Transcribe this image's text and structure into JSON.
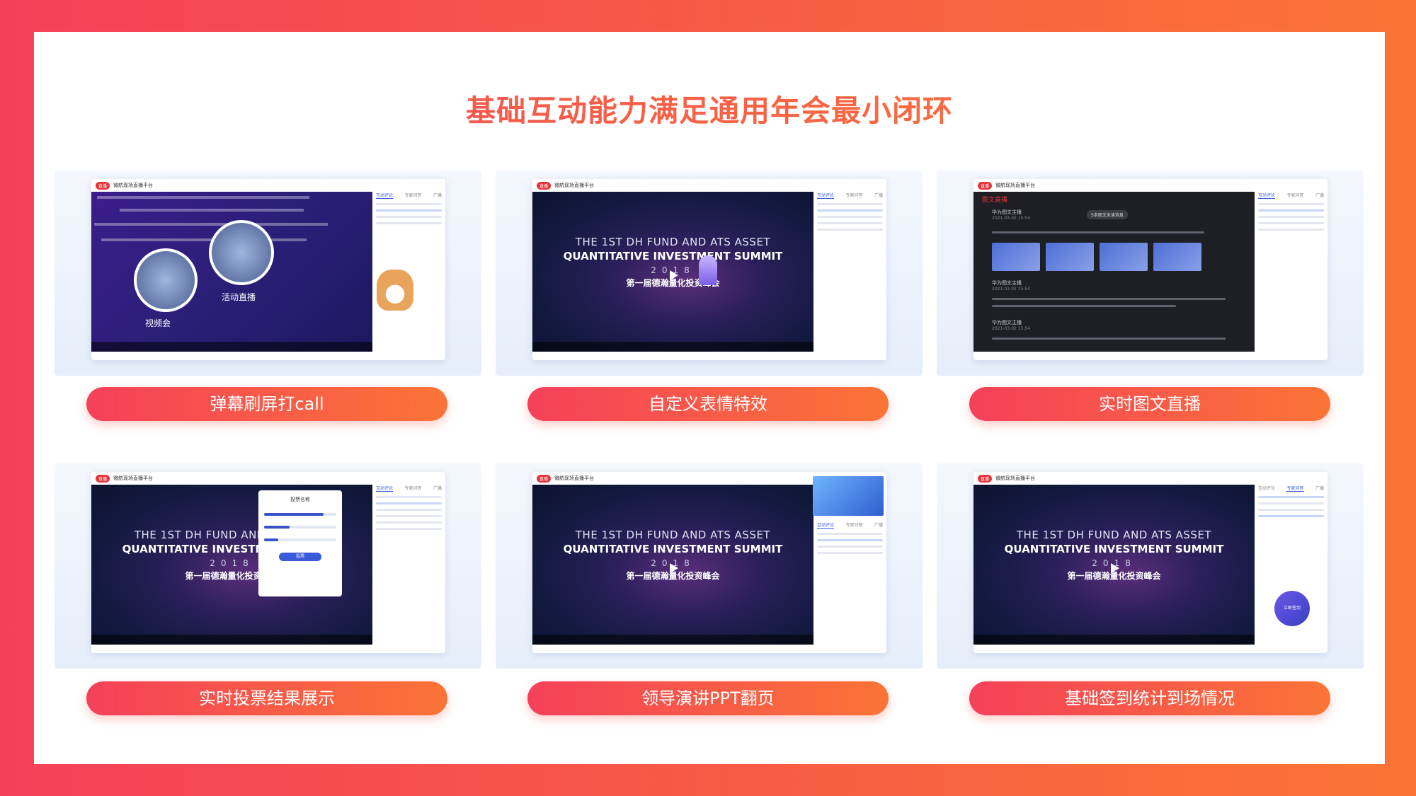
{
  "headline": "基础互动能力满足通用年会最小闭环",
  "app": {
    "live_badge": "直播",
    "name": "微航现场直播平台",
    "side_tabs": [
      "互动评论",
      "专家问答",
      "广播"
    ]
  },
  "summit": {
    "en_line1": "THE 1ST DH FUND AND ATS ASSET",
    "en_line2": "QUANTITATIVE INVESTMENT SUMMIT",
    "year": "2018",
    "cn_line": "第一届德瀚量化投资峰会"
  },
  "tiles": [
    {
      "feature": "弹幕刷屏打call",
      "bubble_labels": [
        "视频会",
        "活动直播"
      ]
    },
    {
      "feature": "自定义表情特效"
    },
    {
      "feature": "实时图文直播",
      "section_title": "图文直播",
      "author": "华为图文主播",
      "time": "2021-03-02 15:54",
      "collapse_tip": "5条图文未读消息"
    },
    {
      "feature": "实时投票结果展示",
      "vote_title": "投票名称",
      "vote_submit": "投票"
    },
    {
      "feature": "领导演讲PPT翻页"
    },
    {
      "feature": "基础签到统计到场情况",
      "checkin_label": "立即签到"
    }
  ],
  "colors": {
    "gradient_start": "#f5405a",
    "gradient_end": "#fb7436",
    "accent_blue": "#3a5bd9"
  }
}
